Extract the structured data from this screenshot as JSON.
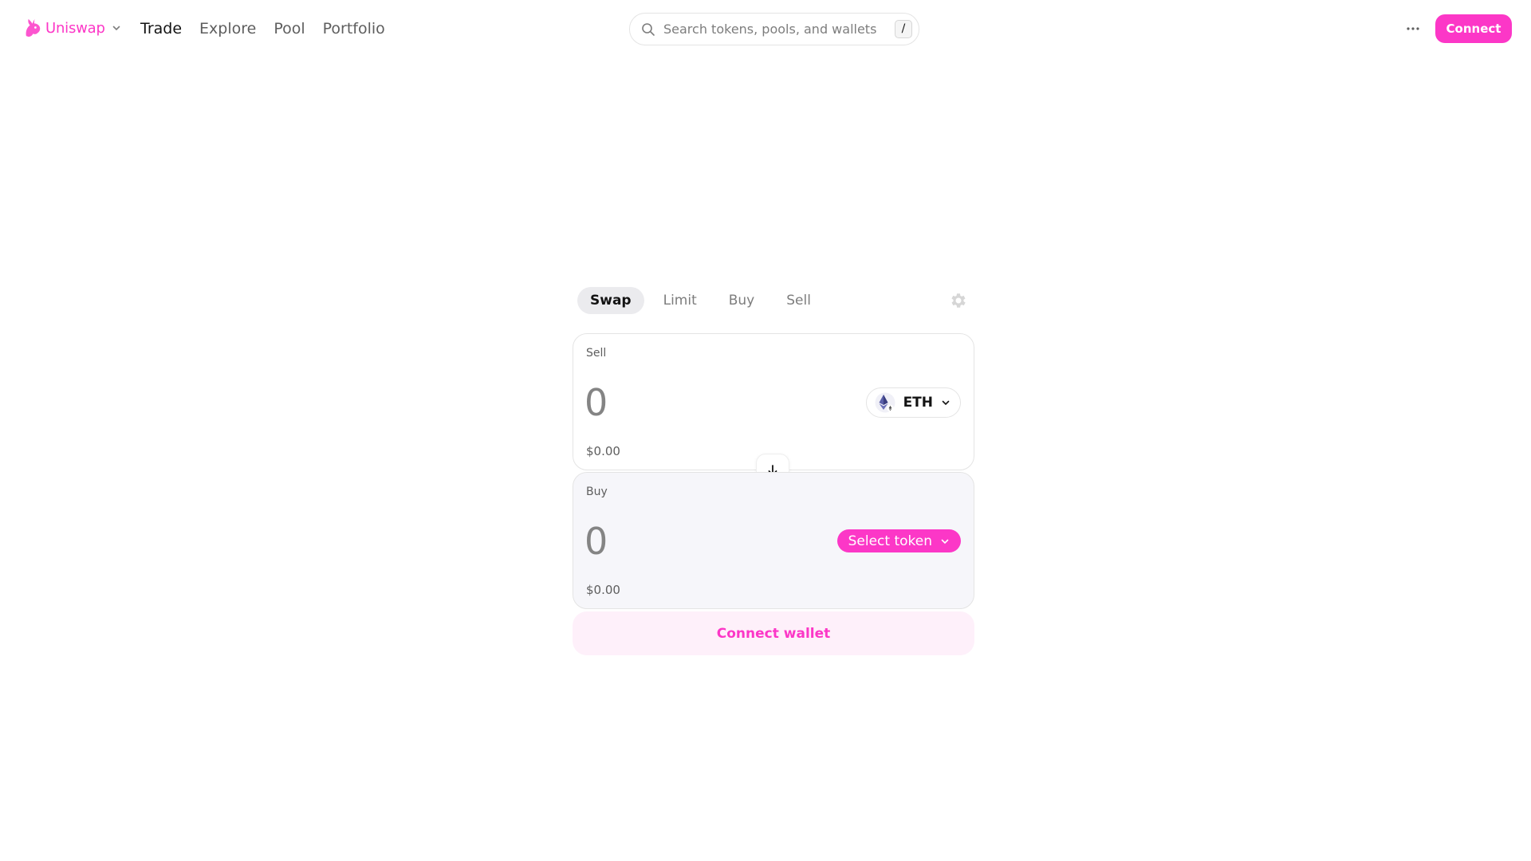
{
  "header": {
    "brand_name": "Uniswap",
    "nav": [
      "Trade",
      "Explore",
      "Pool",
      "Portfolio"
    ],
    "active_nav": "Trade",
    "search_placeholder": "Search tokens, pools, and wallets",
    "search_shortcut": "/",
    "connect_label": "Connect"
  },
  "swap": {
    "tabs": [
      "Swap",
      "Limit",
      "Buy",
      "Sell"
    ],
    "active_tab": "Swap",
    "sell": {
      "label": "Sell",
      "amount_placeholder": "0",
      "usd_value": "$0.00",
      "token_symbol": "ETH"
    },
    "buy": {
      "label": "Buy",
      "amount_placeholder": "0",
      "usd_value": "$0.00",
      "select_token_label": "Select token"
    },
    "connect_wallet_label": "Connect wallet"
  },
  "icons": {
    "logo": "unicorn-logo-icon",
    "search": "search-icon",
    "more": "more-dots-icon",
    "settings": "gear-icon",
    "switch": "arrow-down-icon",
    "token": "eth-icon",
    "chevron": "chevron-down-icon"
  },
  "colors": {
    "accent": "#fc37c7",
    "accent_soft": "#fef0fa",
    "text_primary": "#131313",
    "text_secondary": "#5e5e5e",
    "panel_tint": "#f6f6fa"
  }
}
